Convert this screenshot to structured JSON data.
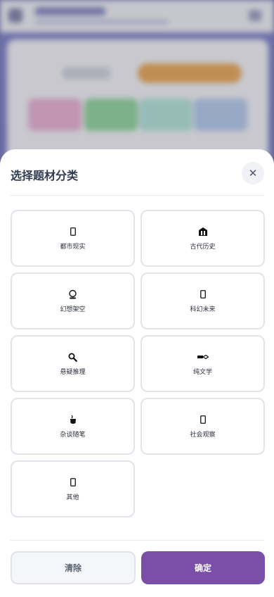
{
  "sheet": {
    "title": "选择题材分类",
    "close_icon": "✕"
  },
  "categories": [
    {
      "label": "都市现实",
      "icon": "phone-icon"
    },
    {
      "label": "古代历史",
      "icon": "temple-icon"
    },
    {
      "label": "幻想架空",
      "icon": "crystal-ball-icon"
    },
    {
      "label": "科幻未来",
      "icon": "rocket-icon"
    },
    {
      "label": "悬疑推理",
      "icon": "magnifier-icon"
    },
    {
      "label": "纯文学",
      "icon": "pen-icon"
    },
    {
      "label": "杂谈随笔",
      "icon": "coffee-icon"
    },
    {
      "label": "社会观察",
      "icon": "people-icon"
    },
    {
      "label": "其他",
      "icon": "note-icon"
    }
  ],
  "buttons": {
    "clear": "清除",
    "confirm": "确定"
  },
  "colors": {
    "accent": "#7a4fa8",
    "title": "#2f3c4f",
    "border": "#e2e4ea",
    "bg_highlight": "#e79a3c"
  }
}
